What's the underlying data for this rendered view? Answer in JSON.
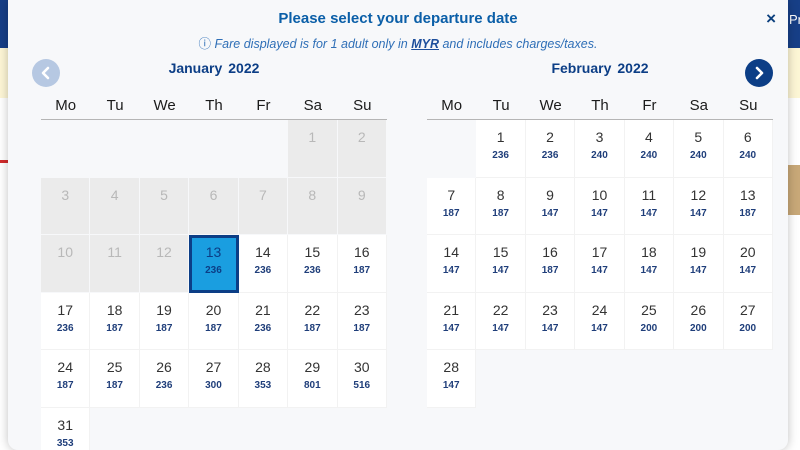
{
  "modal": {
    "title": "Please select your departure date",
    "notice_icon": "ⓘ",
    "notice_prefix": "Fare displayed is for 1 adult only in",
    "currency": "MYR",
    "notice_suffix": "and includes charges/taxes.",
    "close_label": "×"
  },
  "background": {
    "right_fragment": "Pr"
  },
  "nav": {
    "prev_icon": "chevron-left-icon",
    "next_icon": "chevron-right-icon"
  },
  "weekdays": [
    "Mo",
    "Tu",
    "We",
    "Th",
    "Fr",
    "Sa",
    "Su"
  ],
  "colors": {
    "brand": "#0c3e86",
    "selected": "#1a9ee0",
    "title": "#0b5fa8"
  },
  "months": [
    {
      "name": "January",
      "year": "2022",
      "leading_blanks": 5,
      "days": [
        {
          "day": "1",
          "fare": "",
          "state": "disabled"
        },
        {
          "day": "2",
          "fare": "",
          "state": "disabled"
        },
        {
          "day": "3",
          "fare": "",
          "state": "disabled"
        },
        {
          "day": "4",
          "fare": "",
          "state": "disabled"
        },
        {
          "day": "5",
          "fare": "",
          "state": "disabled"
        },
        {
          "day": "6",
          "fare": "",
          "state": "disabled"
        },
        {
          "day": "7",
          "fare": "",
          "state": "disabled"
        },
        {
          "day": "8",
          "fare": "",
          "state": "disabled"
        },
        {
          "day": "9",
          "fare": "",
          "state": "disabled"
        },
        {
          "day": "10",
          "fare": "",
          "state": "disabled"
        },
        {
          "day": "11",
          "fare": "",
          "state": "disabled"
        },
        {
          "day": "12",
          "fare": "",
          "state": "disabled"
        },
        {
          "day": "13",
          "fare": "236",
          "state": "selected"
        },
        {
          "day": "14",
          "fare": "236",
          "state": "avail"
        },
        {
          "day": "15",
          "fare": "236",
          "state": "avail"
        },
        {
          "day": "16",
          "fare": "187",
          "state": "avail"
        },
        {
          "day": "17",
          "fare": "236",
          "state": "avail"
        },
        {
          "day": "18",
          "fare": "187",
          "state": "avail"
        },
        {
          "day": "19",
          "fare": "187",
          "state": "avail"
        },
        {
          "day": "20",
          "fare": "187",
          "state": "avail"
        },
        {
          "day": "21",
          "fare": "236",
          "state": "avail"
        },
        {
          "day": "22",
          "fare": "187",
          "state": "avail"
        },
        {
          "day": "23",
          "fare": "187",
          "state": "avail"
        },
        {
          "day": "24",
          "fare": "187",
          "state": "avail"
        },
        {
          "day": "25",
          "fare": "187",
          "state": "avail"
        },
        {
          "day": "26",
          "fare": "236",
          "state": "avail"
        },
        {
          "day": "27",
          "fare": "300",
          "state": "avail"
        },
        {
          "day": "28",
          "fare": "353",
          "state": "avail"
        },
        {
          "day": "29",
          "fare": "801",
          "state": "avail"
        },
        {
          "day": "30",
          "fare": "516",
          "state": "avail"
        },
        {
          "day": "31",
          "fare": "353",
          "state": "avail"
        }
      ]
    },
    {
      "name": "February",
      "year": "2022",
      "leading_blanks": 1,
      "days": [
        {
          "day": "1",
          "fare": "236",
          "state": "avail"
        },
        {
          "day": "2",
          "fare": "236",
          "state": "avail"
        },
        {
          "day": "3",
          "fare": "240",
          "state": "avail"
        },
        {
          "day": "4",
          "fare": "240",
          "state": "avail"
        },
        {
          "day": "5",
          "fare": "240",
          "state": "avail"
        },
        {
          "day": "6",
          "fare": "240",
          "state": "avail"
        },
        {
          "day": "7",
          "fare": "187",
          "state": "avail"
        },
        {
          "day": "8",
          "fare": "187",
          "state": "avail"
        },
        {
          "day": "9",
          "fare": "147",
          "state": "avail"
        },
        {
          "day": "10",
          "fare": "147",
          "state": "avail"
        },
        {
          "day": "11",
          "fare": "147",
          "state": "avail"
        },
        {
          "day": "12",
          "fare": "147",
          "state": "avail"
        },
        {
          "day": "13",
          "fare": "187",
          "state": "avail"
        },
        {
          "day": "14",
          "fare": "147",
          "state": "avail"
        },
        {
          "day": "15",
          "fare": "147",
          "state": "avail"
        },
        {
          "day": "16",
          "fare": "187",
          "state": "avail"
        },
        {
          "day": "17",
          "fare": "147",
          "state": "avail"
        },
        {
          "day": "18",
          "fare": "147",
          "state": "avail"
        },
        {
          "day": "19",
          "fare": "147",
          "state": "avail"
        },
        {
          "day": "20",
          "fare": "147",
          "state": "avail"
        },
        {
          "day": "21",
          "fare": "147",
          "state": "avail"
        },
        {
          "day": "22",
          "fare": "147",
          "state": "avail"
        },
        {
          "day": "23",
          "fare": "147",
          "state": "avail"
        },
        {
          "day": "24",
          "fare": "147",
          "state": "avail"
        },
        {
          "day": "25",
          "fare": "200",
          "state": "avail"
        },
        {
          "day": "26",
          "fare": "200",
          "state": "avail"
        },
        {
          "day": "27",
          "fare": "200",
          "state": "avail"
        },
        {
          "day": "28",
          "fare": "147",
          "state": "avail"
        }
      ]
    }
  ]
}
